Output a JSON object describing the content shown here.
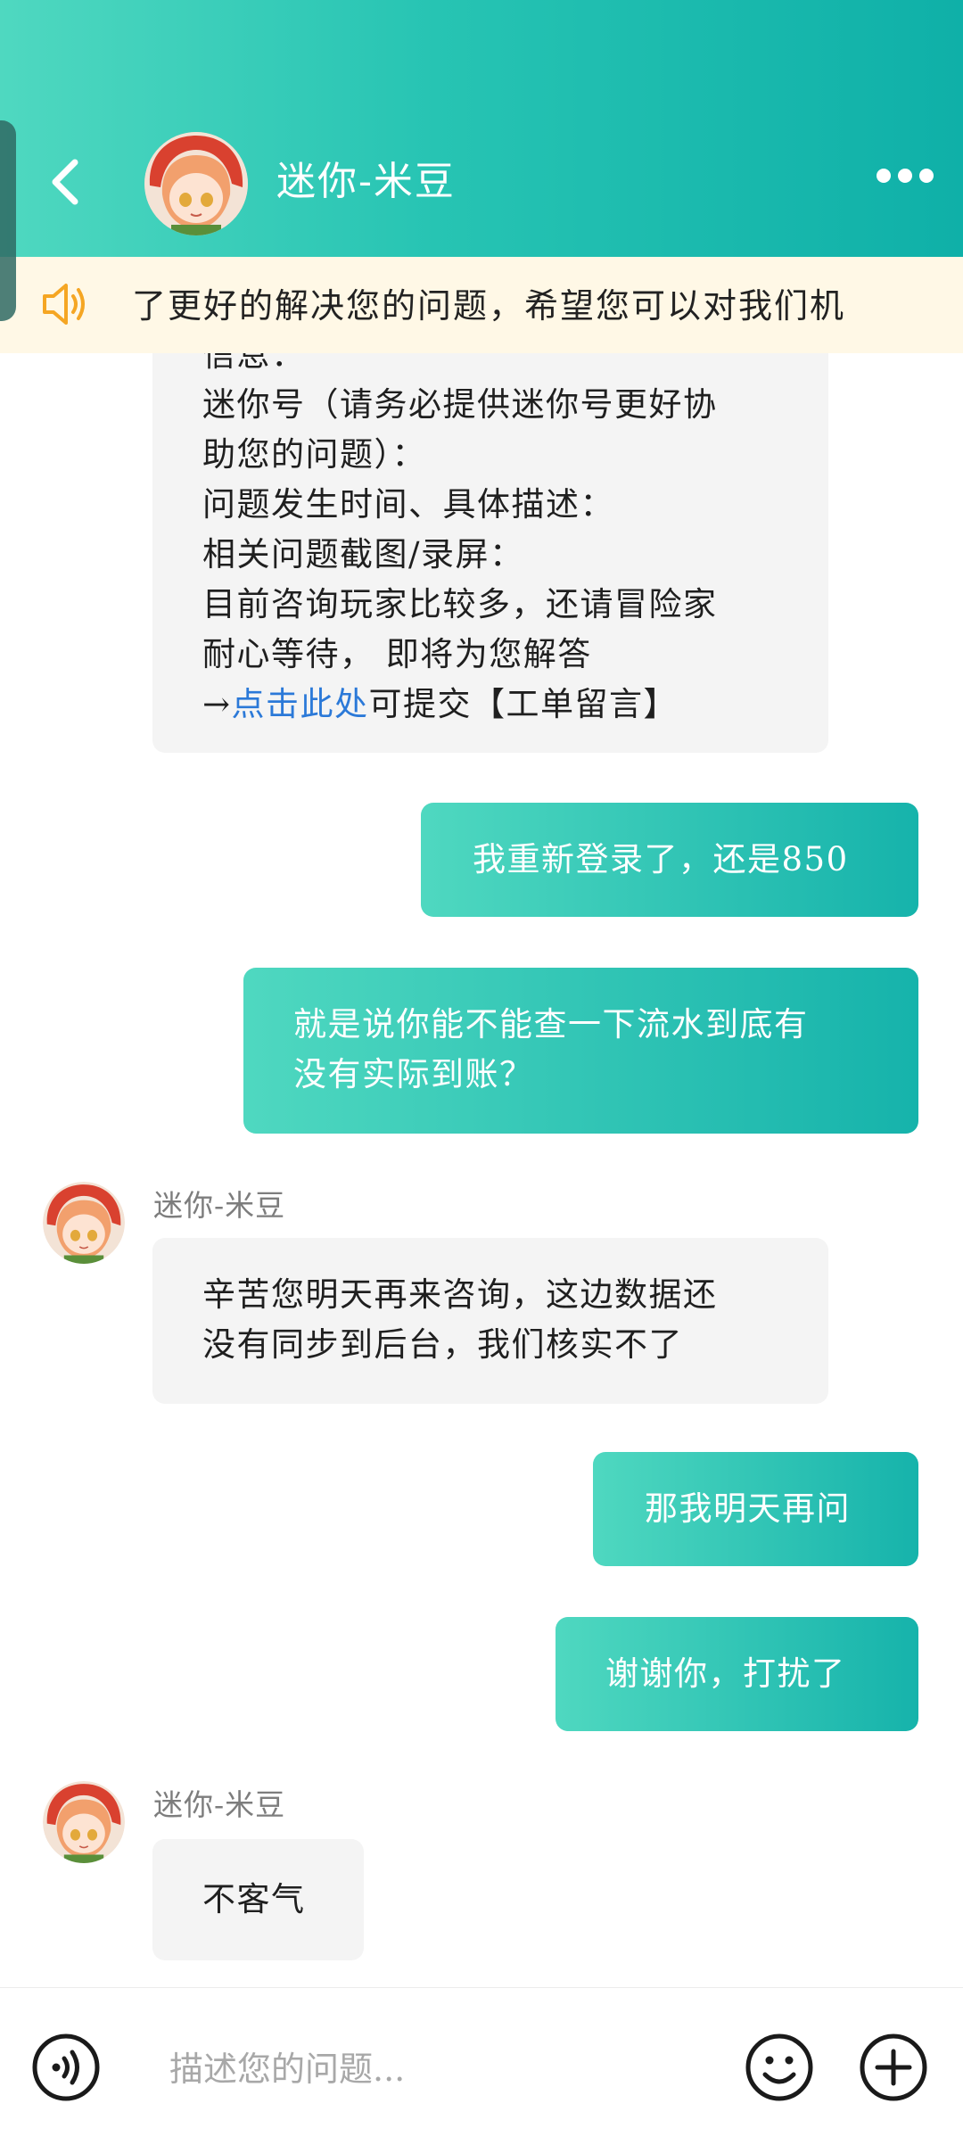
{
  "header": {
    "title": "迷你-米豆"
  },
  "notice": {
    "text": "了更好的解决您的问题，希望您可以对我们机"
  },
  "messages": {
    "m1": {
      "lines": [
        "信息：",
        "迷你号（请务必提供迷你号更好协",
        "助您的问题）：",
        "问题发生时间、具体描述：",
        "相关问题截图/录屏：",
        "目前咨询玩家比较多，还请冒险家",
        "耐心等待， 即将为您解答"
      ],
      "last_prefix": "→",
      "link_text": "点击此处",
      "last_suffix": "可提交【工单留言】"
    },
    "m2": {
      "text": "我重新登录了，还是850"
    },
    "m3": {
      "lines": [
        "就是说你能不能查一下流水到底有",
        "没有实际到账？"
      ]
    },
    "m4": {
      "sender": "迷你-米豆",
      "lines": [
        "辛苦您明天再来咨询，这边数据还",
        "没有同步到后台，我们核实不了"
      ]
    },
    "m5": {
      "text": "那我明天再问"
    },
    "m6": {
      "text": "谢谢你，打扰了"
    },
    "m7": {
      "sender": "迷你-米豆",
      "text": "不客气"
    }
  },
  "input": {
    "placeholder": "描述您的问题..."
  },
  "icons": {
    "back": "chevron-left-icon",
    "more": "more-dots-icon",
    "speaker": "speaker-icon",
    "voice": "voice-icon",
    "emoji": "emoji-icon",
    "plus": "plus-icon"
  },
  "colors": {
    "accent_start": "#4fd8c0",
    "accent_end": "#0fb0a8",
    "notice_bg": "#fff8e6",
    "notice_icon": "#f5a623",
    "link": "#2b79d8"
  }
}
